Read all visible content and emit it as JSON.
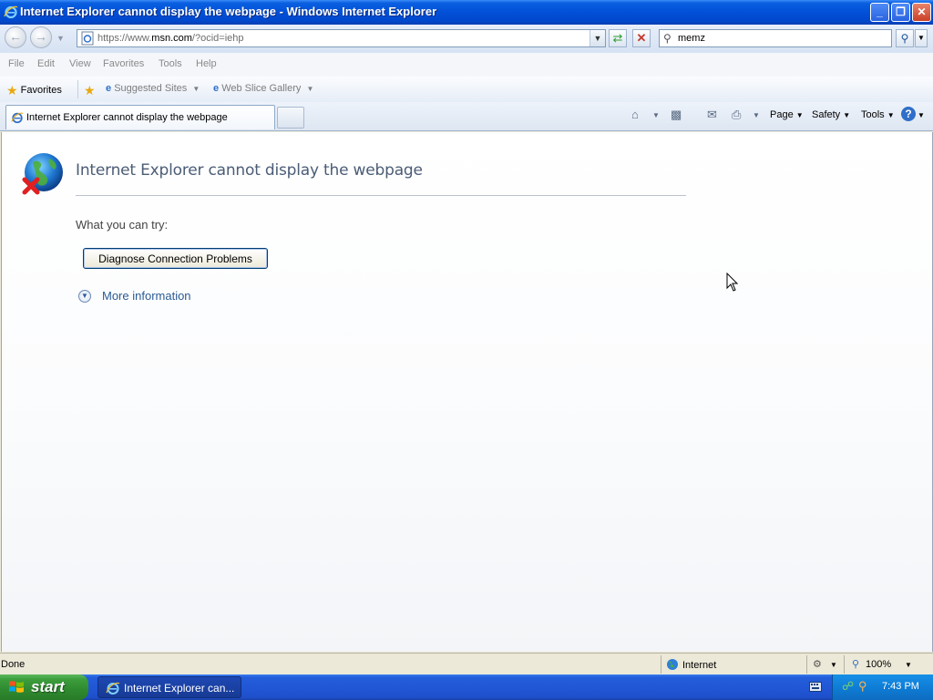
{
  "window": {
    "title": "Internet Explorer cannot display the webpage - Windows Internet Explorer",
    "minimize": "_",
    "restore": "❐",
    "close": "✕"
  },
  "address": {
    "url_prefix": "https://www.",
    "url_domain": "msn.com",
    "url_suffix": "/?ocid=iehp"
  },
  "search": {
    "value": "memz"
  },
  "menu": [
    "File",
    "Edit",
    "View",
    "Favorites",
    "Tools",
    "Help"
  ],
  "favorites": {
    "label": "Favorites",
    "suggested_sites": "Suggested Sites",
    "web_slice_gallery": "Web Slice Gallery"
  },
  "tab": {
    "label": "Internet Explorer cannot display the webpage"
  },
  "commandbar": {
    "page": "Page",
    "safety": "Safety",
    "tools": "Tools"
  },
  "page": {
    "heading": "Internet Explorer cannot display the webpage",
    "try_text": "What you can try:",
    "diagnose_button": "Diagnose Connection Problems",
    "more_info": "More information"
  },
  "status": {
    "text": "Done",
    "zone": "Internet",
    "zoom": "100%"
  },
  "taskbar": {
    "start": "start",
    "task_label": "Internet Explorer can...",
    "clock": "7:43 PM"
  }
}
